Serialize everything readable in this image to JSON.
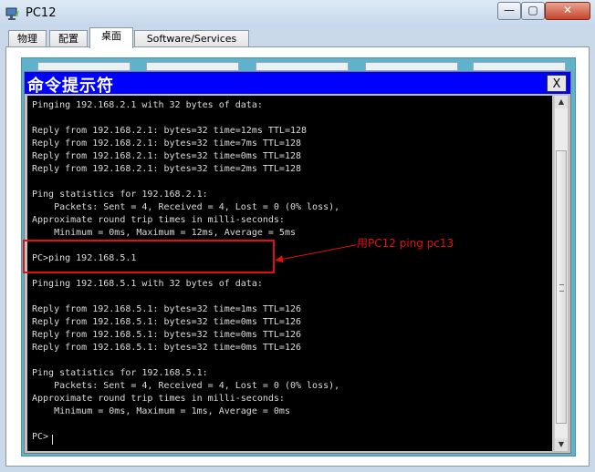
{
  "window": {
    "title": "PC12",
    "minimize_label": "—",
    "maximize_label": "▢",
    "close_label": "✕"
  },
  "tabs": [
    {
      "label": "物理"
    },
    {
      "label": "配置"
    },
    {
      "label": "桌面"
    },
    {
      "label": "Software/Services"
    }
  ],
  "active_tab": "桌面",
  "cmd": {
    "title": "命令提示符",
    "close_label": "X",
    "lines": [
      "Pinging 192.168.2.1 with 32 bytes of data:",
      "",
      "Reply from 192.168.2.1: bytes=32 time=12ms TTL=128",
      "Reply from 192.168.2.1: bytes=32 time=7ms TTL=128",
      "Reply from 192.168.2.1: bytes=32 time=0ms TTL=128",
      "Reply from 192.168.2.1: bytes=32 time=2ms TTL=128",
      "",
      "Ping statistics for 192.168.2.1:",
      "    Packets: Sent = 4, Received = 4, Lost = 0 (0% loss),",
      "Approximate round trip times in milli-seconds:",
      "    Minimum = 0ms, Maximum = 12ms, Average = 5ms",
      "",
      "PC>ping 192.168.5.1",
      "",
      "Pinging 192.168.5.1 with 32 bytes of data:",
      "",
      "Reply from 192.168.5.1: bytes=32 time=1ms TTL=126",
      "Reply from 192.168.5.1: bytes=32 time=0ms TTL=126",
      "Reply from 192.168.5.1: bytes=32 time=0ms TTL=126",
      "Reply from 192.168.5.1: bytes=32 time=0ms TTL=126",
      "",
      "Ping statistics for 192.168.5.1:",
      "    Packets: Sent = 4, Received = 4, Lost = 0 (0% loss),",
      "Approximate round trip times in milli-seconds:",
      "    Minimum = 0ms, Maximum = 1ms, Average = 0ms",
      "",
      "PC>"
    ]
  },
  "annotation": {
    "text": "用PC12 ping pc13",
    "color": "#e01010"
  },
  "colors": {
    "cmd_titlebar": "#0000ff",
    "terminal_bg": "#000000",
    "terminal_fg": "#dcdcdc",
    "desktop_bg": "#5fb2c9"
  }
}
